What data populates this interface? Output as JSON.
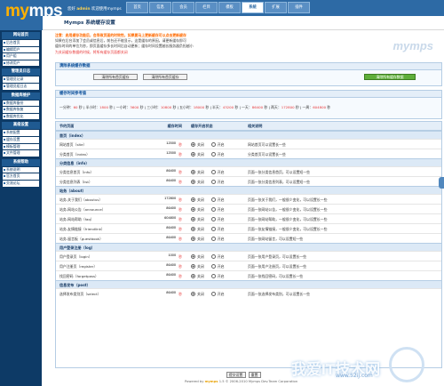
{
  "logo": {
    "a": "my",
    "b": "mps"
  },
  "header": {
    "greeting": "您好",
    "user": "admin",
    "welcome": "欢迎使用mymps"
  },
  "topnav": [
    "首页",
    "信息",
    "会员",
    "栏目",
    "模板",
    "系统",
    "扩展",
    "插件"
  ],
  "topnav_active": 5,
  "toolbar": [
    "刷新",
    "退出",
    "帮助"
  ],
  "sidebar": [
    {
      "title": "网站首页",
      "items": [
        "后台首页",
        "编辑用户",
        "用户组",
        "修改用户"
      ]
    },
    {
      "title": "管理员日志",
      "items": [
        "管理员记录",
        "管理员组日志"
      ]
    },
    {
      "title": "数据库维护",
      "items": [
        "数据库备份",
        "数据库恢复",
        "数据库优化"
      ]
    },
    {
      "title": "高级设置",
      "items": [
        "系统配置",
        "缓存设置",
        "模板管理",
        "文件管理"
      ]
    },
    {
      "title": "系统帮助",
      "items": [
        "系统说明",
        "官方首页",
        "交流论坛"
      ]
    }
  ],
  "page_title": "Mymps 系统缓存设置",
  "tips": [
    {
      "t": "注意：启用缓存功能后，会导致页面的时效性，如果要马上更新缓存可以点击更新缓存",
      "c": "warn"
    },
    {
      "t": "如果在后台添加了会员或信息后，前台还不能显示，这是缓存的原因，请更新缓存即可",
      "c": ""
    },
    {
      "t": "缓存时间的单位为秒，即页面缓存多长时间后自动更新；缓存时间设置越长服务器负担越小",
      "c": ""
    },
    {
      "t": "为关闭缓存数据的时候，将所有缓存页面都关闭",
      "c": "red"
    }
  ],
  "watermark_logo": "mymps",
  "panel1": {
    "title": "清除系统缓存数据",
    "btn1": "清除所有首页缓存",
    "btn2": "清除所有首页缓存",
    "btn3": "清除所有缓存数据"
  },
  "panel2": {
    "title": "缓存时间参考值",
    "values": [
      {
        "k": "一分钟",
        "v": "60"
      },
      {
        "k": "半小时",
        "v": "1800"
      },
      {
        "k": "一小时",
        "v": "3600"
      },
      {
        "k": "三小时",
        "v": "10800"
      },
      {
        "k": "五小时",
        "v": "18000"
      },
      {
        "k": "半天",
        "v": "43200"
      },
      {
        "k": "一天",
        "v": "86400"
      },
      {
        "k": "两天",
        "v": "172800"
      },
      {
        "k": "一周",
        "v": "604800"
      }
    ],
    "unit": "秒"
  },
  "table": {
    "h1": "节约页面",
    "h2": "缓存时间",
    "h3": "缓存开启状态",
    "h4": "相关说明",
    "sec": "秒",
    "off": "关闭",
    "on": "开启",
    "groups": [
      {
        "title": "首页（index）",
        "rows": [
          {
            "n": "网站首页（site）",
            "t": "12000",
            "s": 0,
            "d": "网站首页可以设置长一些"
          },
          {
            "n": "分类首页（index）",
            "t": "12000",
            "s": 0,
            "d": "分类首页可以设置长一些"
          }
        ]
      },
      {
        "title": "分类信息（info）",
        "rows": [
          {
            "n": "分类信息首页（info）",
            "t": "86400",
            "s": 0,
            "d": "页面一张分类信息首页，可以设置短一些"
          },
          {
            "n": "分类信息列表（list）",
            "t": "86400",
            "s": 0,
            "d": "页面一张分类信息列表，可以设置短一些"
          }
        ]
      },
      {
        "title": "站务（about）",
        "rows": [
          {
            "n": "站务-关于我们（aboutus）",
            "t": "172800",
            "s": 0,
            "d": "页面一张关于我们，一般很少变化，可以设置长一些"
          },
          {
            "n": "站务-网站公告（announce）",
            "t": "86400",
            "s": 0,
            "d": "页面一张网站公告，一般很少变化，可以设置长一些"
          },
          {
            "n": "站务-网站帮助（faq）",
            "t": "604800",
            "s": 0,
            "d": "页面一张网站帮助，一般很少变化，可以设置长一些"
          },
          {
            "n": "站务-友情链接（friendlink）",
            "t": "86400",
            "s": 0,
            "d": "页面一张友情链接，一般很少变化，可以设置长一些"
          },
          {
            "n": "站务-留言板（guestbook）",
            "t": "86400",
            "s": 0,
            "d": "页面一张网站留言，可以设置短一些"
          }
        ]
      },
      {
        "title": "用户登录注册（log）",
        "rows": [
          {
            "n": "用户登录页（login）",
            "t": "1000",
            "s": 0,
            "d": "页面一张用户登录页，可以设置长一些"
          },
          {
            "n": "用户注册页（register）",
            "t": "86400",
            "s": 0,
            "d": "页面一张用户注册页，可以设置长一些"
          },
          {
            "n": "找回密码（forgetpass）",
            "t": "86400",
            "s": 0,
            "d": "页面一张找回密码，可以设置长一些"
          }
        ]
      },
      {
        "title": "信息发布（post）",
        "rows": [
          {
            "n": "选择发布类别页（select）",
            "t": "86400",
            "s": 0,
            "d": "页面一张选择发布类别，可以设置长一些"
          }
        ]
      }
    ]
  },
  "foot": {
    "save": "提交设置",
    "reset": "重置"
  },
  "powered": {
    "a": "Powered by",
    "b": "mymps",
    "c": "1.5 © 2006-2010 Mymps Dev.Team Corporation"
  },
  "watermark": {
    "a": "我爱IT技术网",
    "b": "www.52ij.com"
  }
}
